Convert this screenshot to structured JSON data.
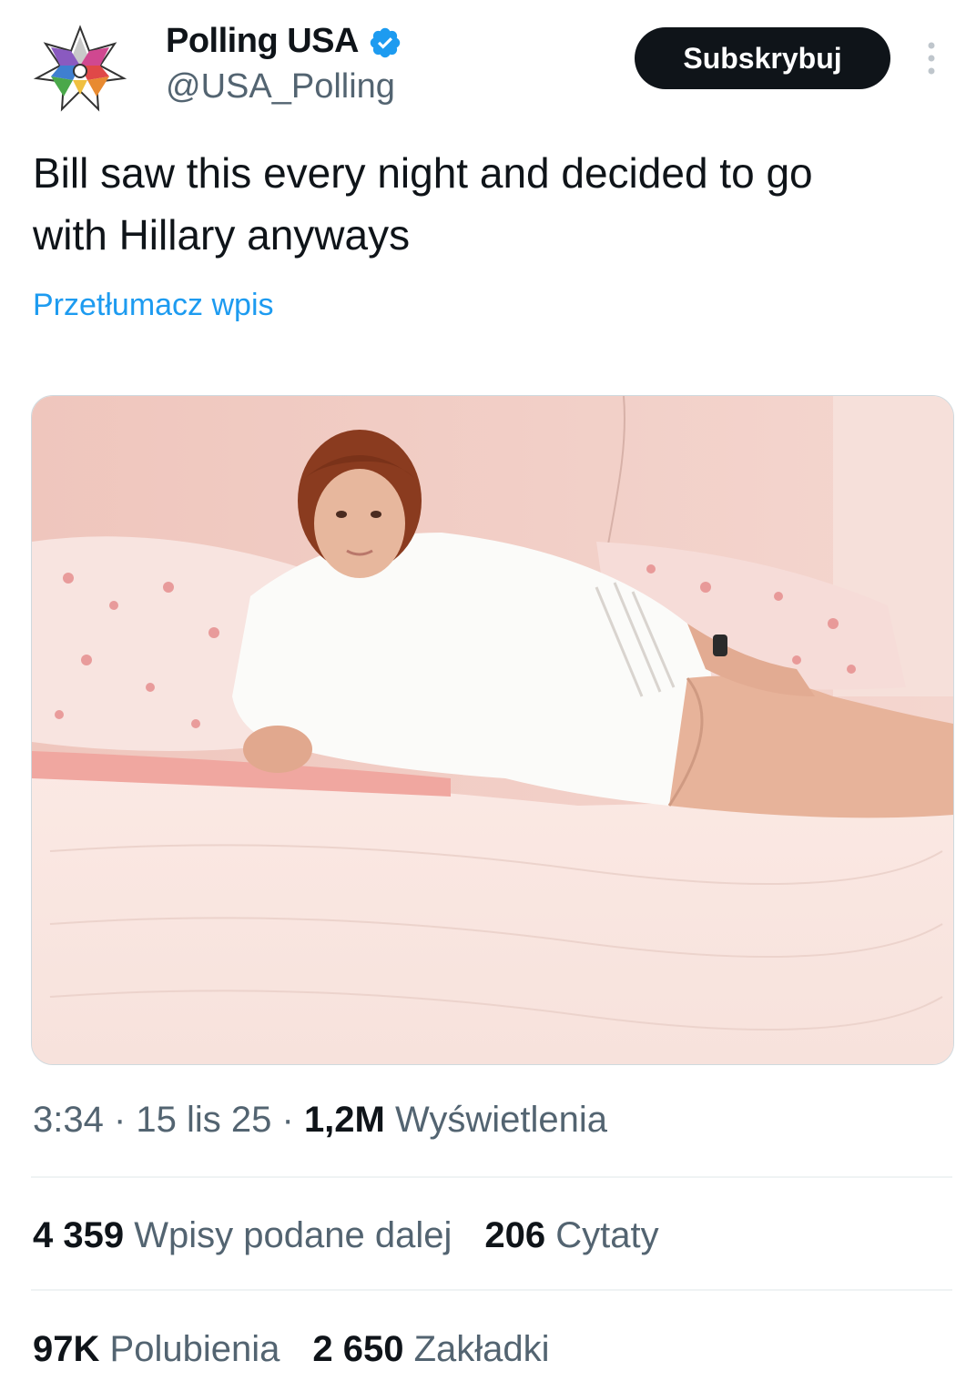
{
  "author": {
    "display_name": "Polling USA",
    "handle": "@USA_Polling",
    "avatar_icon": "polling-usa-star-logo-icon",
    "verified_icon": "verified-badge-icon",
    "verified_color": "#1d9bf0"
  },
  "header": {
    "subscribe_label": "Subskrybuj",
    "more_icon": "more-vertical-icon"
  },
  "tweet": {
    "text_line1": "Bill saw this every night and decided to go",
    "text_line2": "with Hillary anyways",
    "translate_label": "Przetłumacz wpis",
    "media_icon": "photo"
  },
  "meta": {
    "time": "3:34",
    "sep1": " · ",
    "date": "15 lis 25",
    "sep2": " · ",
    "views_count": "1,2M",
    "views_label": "Wyświetlenia"
  },
  "stats_row1": {
    "reposts_count": "4 359",
    "reposts_label": "Wpisy podane dalej",
    "quotes_count": "206",
    "quotes_label": "Cytaty"
  },
  "stats_row2": {
    "likes_count": "97K",
    "likes_label": "Polubienia",
    "bookmarks_count": "2 650",
    "bookmarks_label": "Zakładki"
  },
  "colors": {
    "text": "#0f1419",
    "secondary": "#536471",
    "link": "#1d9bf0",
    "button_bg": "#0f1419",
    "divider": "#eff3f4"
  }
}
